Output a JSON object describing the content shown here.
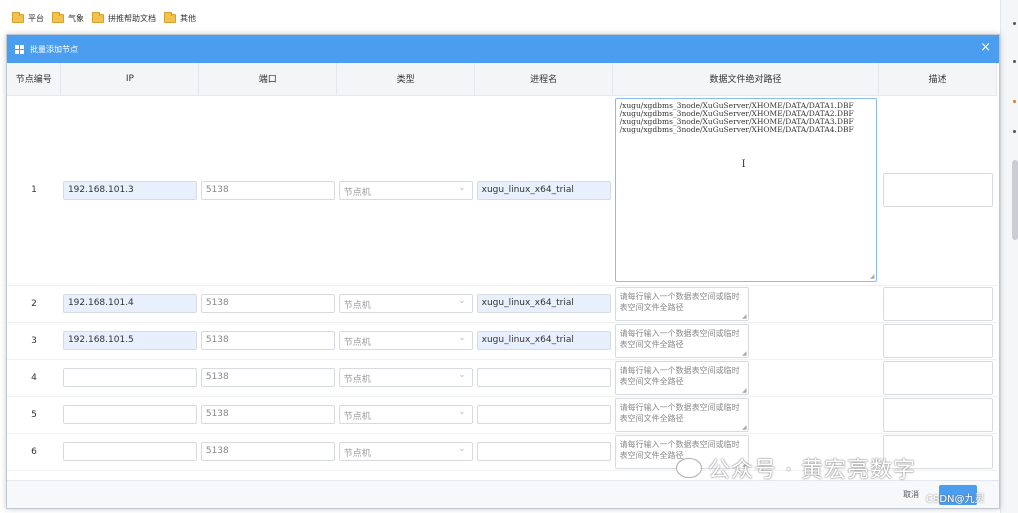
{
  "bookmarks": [
    "平台",
    "气象",
    "拼推帮助文档",
    "其他"
  ],
  "modal": {
    "title": "批量添加节点",
    "close": "×",
    "cancel_label": "取消"
  },
  "table": {
    "headers": [
      "节点编号",
      "IP",
      "端口",
      "类型",
      "进程名",
      "数据文件绝对路径",
      "描述"
    ],
    "path_placeholder": "请每行输入一个数据表空间或临时表空间文件全路径",
    "rows": [
      {
        "no": "1",
        "ip": "192.168.101.3",
        "port": "5138",
        "type": "节点机",
        "proc": "xugu_linux_x64_trial"
      },
      {
        "no": "2",
        "ip": "192.168.101.4",
        "port": "5138",
        "type": "节点机",
        "proc": "xugu_linux_x64_trial"
      },
      {
        "no": "3",
        "ip": "192.168.101.5",
        "port": "5138",
        "type": "节点机",
        "proc": "xugu_linux_x64_trial"
      },
      {
        "no": "4",
        "ip": "",
        "port": "5138",
        "type": "节点机",
        "proc": ""
      },
      {
        "no": "5",
        "ip": "",
        "port": "5138",
        "type": "节点机",
        "proc": ""
      },
      {
        "no": "6",
        "ip": "",
        "port": "5138",
        "type": "节点机",
        "proc": ""
      }
    ],
    "row1_paths": "/xugu/xgdbms_3node/XuGuServer/XHOME/DATA/DATA1.DBF\n/xugu/xgdbms_3node/XuGuServer/XHOME/DATA/DATA2.DBF\n/xugu/xgdbms_3node/XuGuServer/XHOME/DATA/DATA3.DBF\n/xugu/xgdbms_3node/XuGuServer/XHOME/DATA/DATA4.DBF"
  },
  "watermark": {
    "text": "公众号 · 黄宏亮数字",
    "csdn": "CSDN@九灵"
  },
  "colors": {
    "header_blue": "#4b9df0",
    "filled_input": "#e8f0fe"
  }
}
